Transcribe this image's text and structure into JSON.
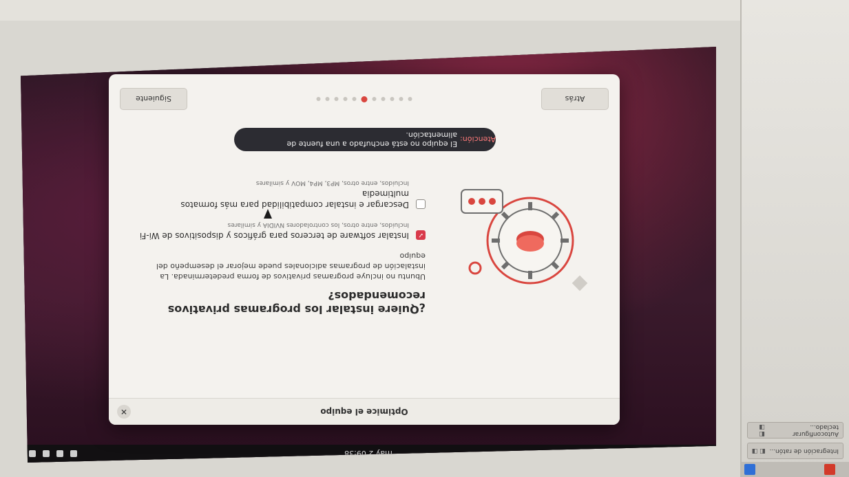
{
  "window": {
    "title": "Optimice el equipo",
    "question": "¿Quiere instalar los programas privativos recomendados?",
    "description": "Ubuntu no incluye programas privativos de forma predeterminada. La instalación de programas adicionales puede mejorar el desempeño del equipo"
  },
  "options": [
    {
      "label": "Instalar software de terceros para gráficos y dispositivos de Wi-Fi",
      "sublabel": "Incluidos, entre otros, los controladores NVIDIA y similares",
      "checked": true
    },
    {
      "label": "Descargar e instalar compatibilidad para más formatos multimedia",
      "sublabel": "Incluidos, entre otros, MP3, MP4, MOV y similares",
      "checked": false
    }
  ],
  "toast": {
    "label": "Atención:",
    "message": "El equipo no está enchufado a una fuente de alimentación."
  },
  "footer": {
    "back_label": "Atrás",
    "next_label": "Siguiente",
    "step_count": 11,
    "active_step": 6
  },
  "topbar": {
    "clock": "may 2 09:38"
  },
  "taskbar": {
    "items": [
      {
        "label": "Autoconfigurar teclado..."
      },
      {
        "label": "Integración de ratón..."
      }
    ]
  },
  "colors": {
    "accent": "#d93a4a",
    "toast_bg": "#2c2c32",
    "window_bg": "#f4f2ee"
  }
}
